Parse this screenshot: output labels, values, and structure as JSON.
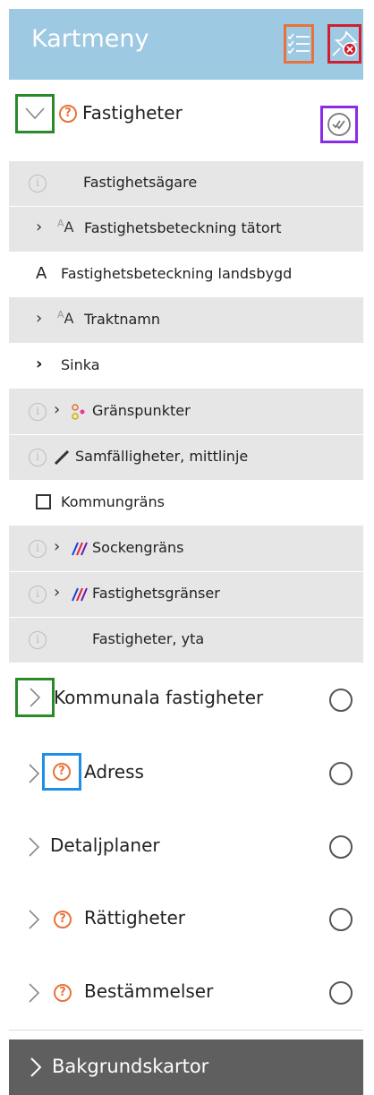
{
  "header": {
    "title": "Kartmeny"
  },
  "group_fastigheter": {
    "label": "Fastigheter",
    "sublayers": [
      {
        "label": "Fastighetsägare"
      },
      {
        "label": "Fastighetsbeteckning tätort"
      },
      {
        "label": "Fastighetsbeteckning landsbygd"
      },
      {
        "label": "Traktnamn"
      },
      {
        "label": "Sinka"
      },
      {
        "label": "Gränspunkter"
      },
      {
        "label": "Samfälligheter, mittlinje"
      },
      {
        "label": "Kommungräns"
      },
      {
        "label": "Sockengräns"
      },
      {
        "label": "Fastighetsgränser"
      },
      {
        "label": "Fastigheter, yta"
      }
    ]
  },
  "groups": [
    {
      "label": "Kommunala fastigheter"
    },
    {
      "label": "Adress"
    },
    {
      "label": "Detaljplaner"
    },
    {
      "label": "Rättigheter"
    },
    {
      "label": "Bestämmelser"
    }
  ],
  "footer": {
    "label": "Bakgrundskartor"
  },
  "colors": {
    "header_bg": "#9ec9e2",
    "accent_orange": "#e8733a",
    "accent_red": "#d0202f",
    "accent_green": "#2a8a2a",
    "accent_purple": "#8b2ce8",
    "accent_blue": "#1e8fe8",
    "footer_bg": "#5f5f5f"
  },
  "icons": {
    "list": "list-check-icon",
    "pin": "unpin-icon",
    "help": "question-circle-icon",
    "info": "info-circle-icon"
  }
}
